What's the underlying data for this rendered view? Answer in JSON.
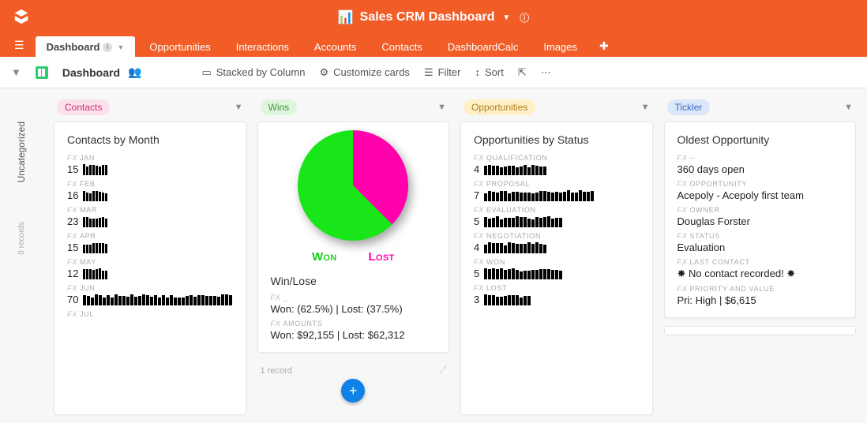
{
  "app": {
    "title": "Sales CRM Dashboard"
  },
  "tabs": [
    "Dashboard",
    "Opportunities",
    "Interactions",
    "Accounts",
    "Contacts",
    "DashboardCalc",
    "Images"
  ],
  "toolbar": {
    "block_title": "Dashboard",
    "stacked": "Stacked by Column",
    "customize": "Customize cards",
    "filter": "Filter",
    "sort": "Sort"
  },
  "rail": {
    "group": "Uncategorized",
    "records": "0 records"
  },
  "columns": {
    "contacts": {
      "chip": "Contacts",
      "card_title": "Contacts by Month",
      "rows": [
        {
          "label": "JAN",
          "value": "15"
        },
        {
          "label": "FEB",
          "value": "16"
        },
        {
          "label": "MAR",
          "value": "23"
        },
        {
          "label": "APR",
          "value": "15"
        },
        {
          "label": "MAY",
          "value": "12"
        },
        {
          "label": "JUN",
          "value": "70"
        },
        {
          "label": "JUL",
          "value": ""
        }
      ]
    },
    "wins": {
      "chip": "Wins",
      "card_title": "Win/Lose",
      "dash_label": "_",
      "summary": "Won: (62.5%) | Lost: (37.5%)",
      "amounts_label": "AMOUNTS",
      "amounts": "Won: $92,155 | Lost: $62,312",
      "won_legend": "Won",
      "lost_legend": "Lost",
      "footer": "1 record"
    },
    "opps": {
      "chip": "Opportunities",
      "card_title": "Opportunities by Status",
      "rows": [
        {
          "label": "QUALIFICATION",
          "value": "4"
        },
        {
          "label": "PROPOSAL",
          "value": "7"
        },
        {
          "label": "EVALUATION",
          "value": "5"
        },
        {
          "label": "NEGOTIATION",
          "value": "4"
        },
        {
          "label": "WON",
          "value": "5"
        },
        {
          "label": "LOST",
          "value": "3"
        }
      ]
    },
    "tickler": {
      "chip": "Tickler",
      "card_title": "Oldest Opportunity",
      "fields": [
        {
          "label": "--",
          "value": "360 days open"
        },
        {
          "label": "OPPORTUNITY",
          "value": "Acepoly - Acepoly first team"
        },
        {
          "label": "OWNER",
          "value": "Douglas Forster"
        },
        {
          "label": "STATUS",
          "value": "Evaluation"
        },
        {
          "label": "LAST CONTACT",
          "value": "✸ No contact recorded! ✸"
        },
        {
          "label": "PRIORITY AND VALUE",
          "value": "Pri: High | $6,615"
        }
      ]
    }
  },
  "chart_data": {
    "type": "pie",
    "title": "Win/Lose",
    "series": [
      {
        "name": "Won",
        "value": 62.5,
        "color": "#19e619"
      },
      {
        "name": "Lost",
        "value": 37.5,
        "color": "#ff00aa"
      }
    ]
  }
}
